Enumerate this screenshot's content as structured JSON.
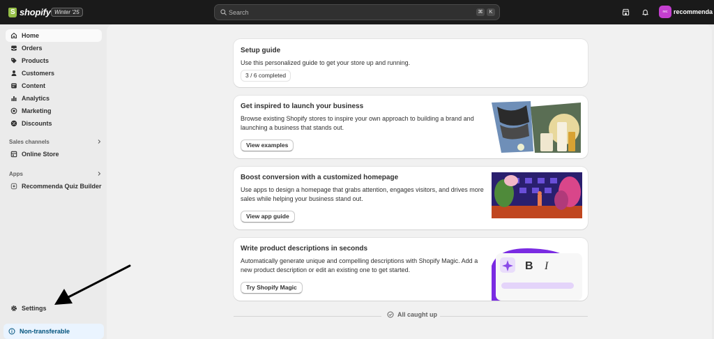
{
  "topbar": {
    "brand": "shopify",
    "edition": "Winter '25",
    "search_placeholder": "Search",
    "shortcut_keys": [
      "⌘",
      "K"
    ],
    "avatar_initials": "rec",
    "store_name": "recommenda"
  },
  "sidebar": {
    "items": [
      {
        "label": "Home",
        "icon": "home-icon"
      },
      {
        "label": "Orders",
        "icon": "inbox-icon"
      },
      {
        "label": "Products",
        "icon": "tag-icon"
      },
      {
        "label": "Customers",
        "icon": "person-icon"
      },
      {
        "label": "Content",
        "icon": "content-icon"
      },
      {
        "label": "Analytics",
        "icon": "bar-chart-icon"
      },
      {
        "label": "Marketing",
        "icon": "target-icon"
      },
      {
        "label": "Discounts",
        "icon": "discount-icon"
      }
    ],
    "sales_channels_label": "Sales channels",
    "online_store_label": "Online Store",
    "apps_label": "Apps",
    "app_label": "Recommenda Quiz Builder",
    "settings_label": "Settings",
    "banner_label": "Non-transferable"
  },
  "main": {
    "setup": {
      "title": "Setup guide",
      "body": "Use this personalized guide to get your store up and running.",
      "progress": "3 / 6 completed"
    },
    "inspire": {
      "title": "Get inspired to launch your business",
      "body": "Browse existing Shopify stores to inspire your own approach to building a brand and launching a business that stands out.",
      "button": "View examples"
    },
    "boost": {
      "title": "Boost conversion with a customized homepage",
      "body": "Use apps to design a homepage that grabs attention, engages visitors, and drives more sales while helping your business stand out.",
      "button": "View app guide"
    },
    "magic": {
      "title": "Write product descriptions in seconds",
      "body": "Automatically generate unique and compelling descriptions with Shopify Magic. Add a new product description or edit an existing one to get started.",
      "button": "Try Shopify Magic"
    },
    "caught_up": "All caught up"
  },
  "colors": {
    "topbar_bg": "#1a1a1a",
    "shopify_green": "#95bf47",
    "avatar_bg": "#c43fd0",
    "banner_bg": "#eaf4ff"
  }
}
